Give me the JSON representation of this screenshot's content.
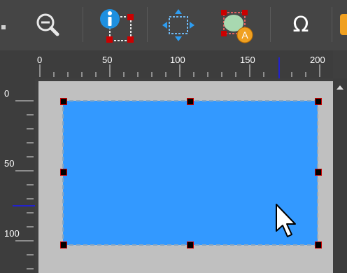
{
  "toolbar": {
    "buttons": [
      {
        "name": "zoom-out",
        "icon": "zoom-out-icon"
      },
      {
        "name": "object-info",
        "icon": "info-selection-icon"
      },
      {
        "name": "move-selection",
        "icon": "move-arrows-icon"
      },
      {
        "name": "auto-fit",
        "icon": "auto-shape-icon",
        "badge": "A"
      },
      {
        "name": "insert-symbol",
        "icon": "omega-icon",
        "label": "Ω"
      },
      {
        "name": "overflow",
        "icon": "orange-button-icon"
      }
    ]
  },
  "ruler_top": {
    "labels": [
      "0",
      "50",
      "100",
      "150",
      "200"
    ]
  },
  "ruler_left": {
    "labels": [
      "0",
      "50",
      "100"
    ]
  },
  "colors": {
    "toolbar_bg": "#454545",
    "ruler_bg": "#3d3d3d",
    "canvas_bg": "#c0c0c0",
    "shape_fill": "#3399ff",
    "handle": "#000000",
    "handle_border": "#cc0000",
    "guide": "#2222cc"
  }
}
